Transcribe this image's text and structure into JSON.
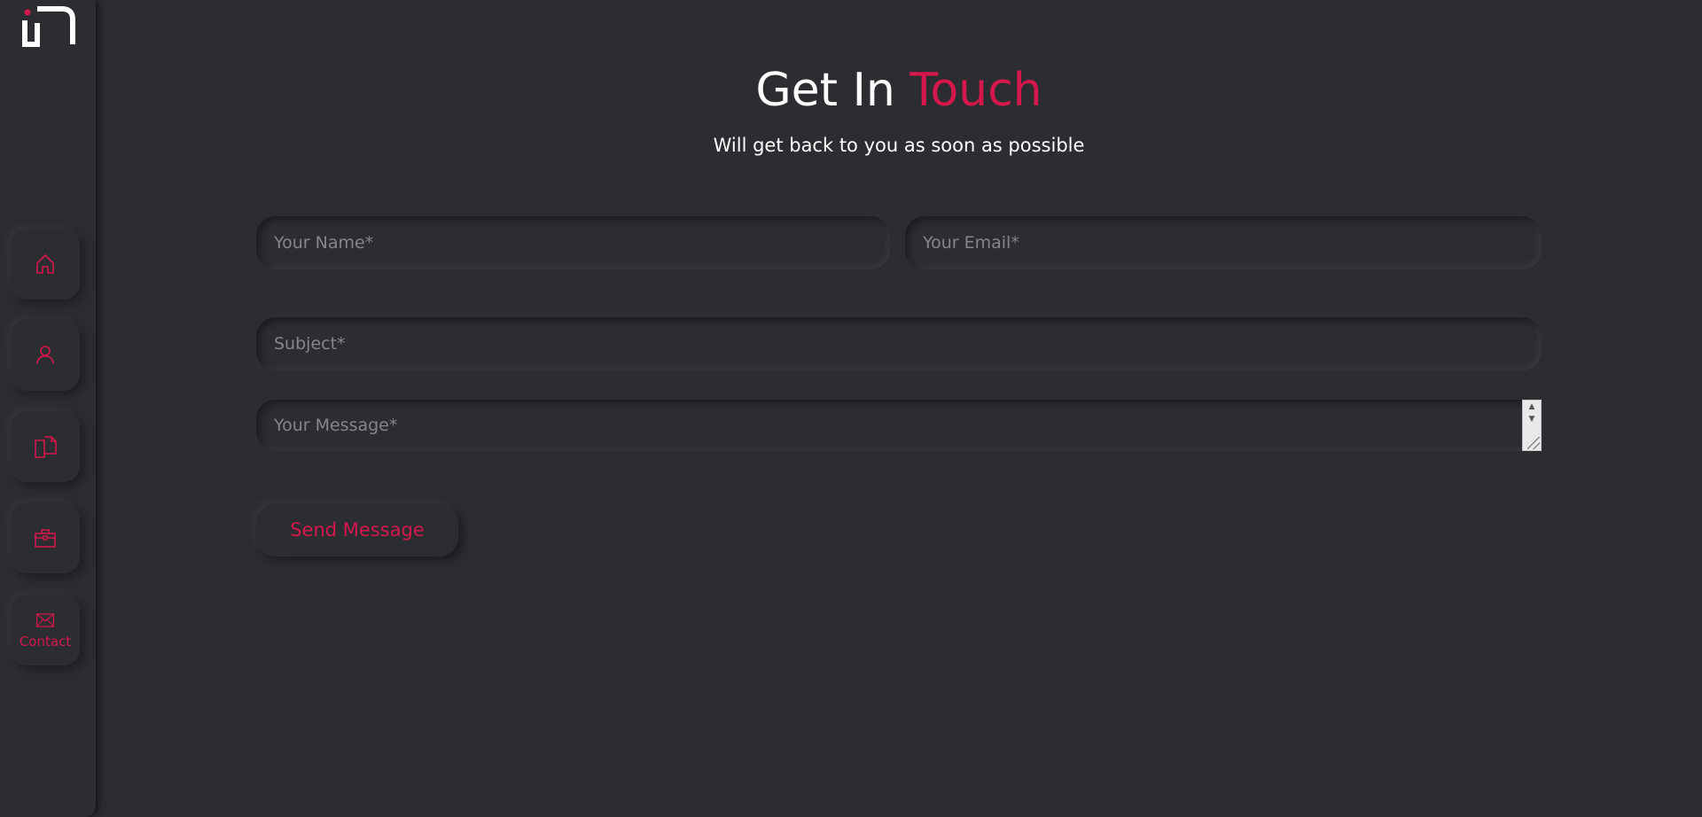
{
  "accent_color": "#d4174c",
  "background_color": "#2c2d31",
  "brand": {
    "logo_icon": "brand-logo-icon"
  },
  "sidebar": {
    "items": [
      {
        "icon": "home-icon",
        "label": ""
      },
      {
        "icon": "user-icon",
        "label": ""
      },
      {
        "icon": "documents-icon",
        "label": ""
      },
      {
        "icon": "briefcase-icon",
        "label": ""
      },
      {
        "icon": "mail-icon",
        "label": "Contact"
      }
    ]
  },
  "header": {
    "title_main": "Get In ",
    "title_accent": "Touch",
    "subtitle": "Will get back to you as soon as possible"
  },
  "form": {
    "name_placeholder": "Your Name*",
    "email_placeholder": "Your Email*",
    "subject_placeholder": "Subject*",
    "message_placeholder": "Your Message*",
    "send_label": "Send Message"
  }
}
